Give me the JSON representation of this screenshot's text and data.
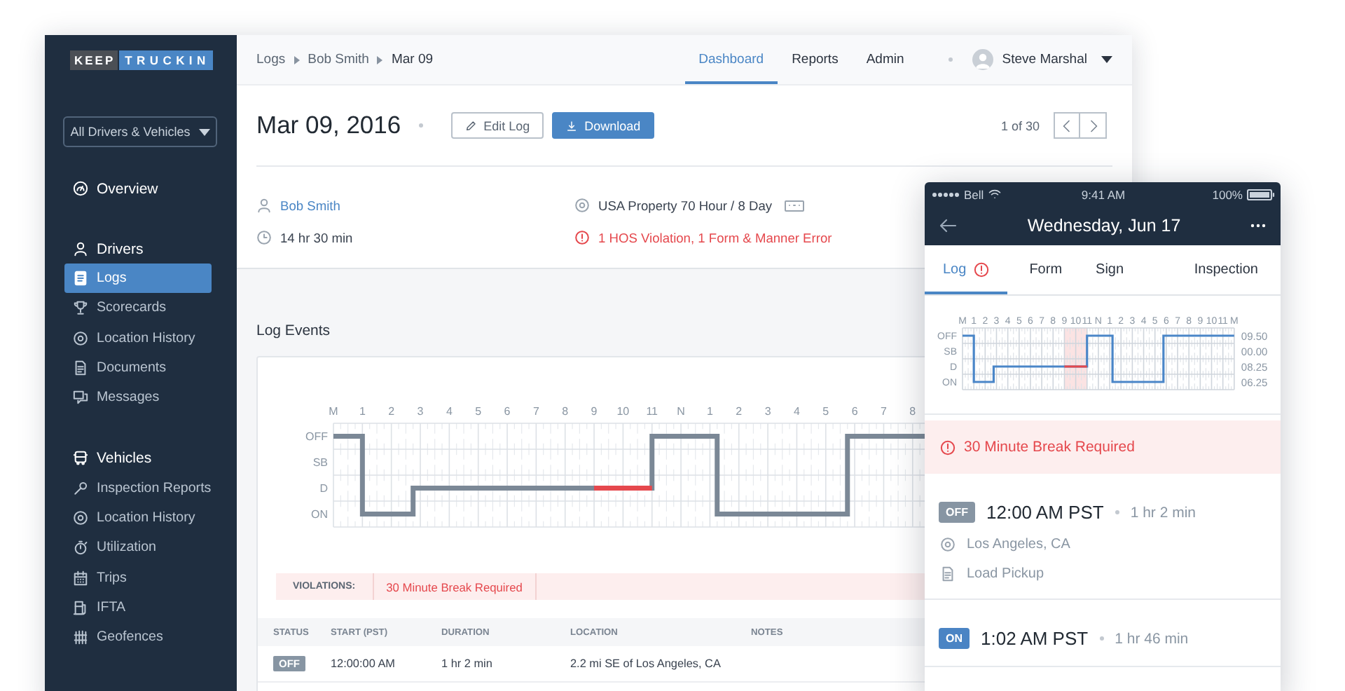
{
  "sidebar": {
    "logo": [
      "KEEP",
      "TRUCKIN"
    ],
    "filter": "All Drivers & Vehicles",
    "nav": [
      {
        "label": "Overview",
        "kind": "top"
      },
      {
        "label": "Drivers",
        "kind": "group",
        "children": [
          {
            "label": "Logs",
            "selected": true
          },
          {
            "label": "Scorecards",
            "selected": false
          },
          {
            "label": "Location History",
            "selected": false
          },
          {
            "label": "Documents",
            "selected": false
          },
          {
            "label": "Messages",
            "selected": false
          }
        ]
      },
      {
        "label": "Vehicles",
        "kind": "group",
        "children": [
          {
            "label": "Inspection Reports",
            "selected": false
          },
          {
            "label": "Location History",
            "selected": false
          },
          {
            "label": "Utilization",
            "selected": false
          },
          {
            "label": "Trips",
            "selected": false
          },
          {
            "label": "IFTA",
            "selected": false
          },
          {
            "label": "Geofences",
            "selected": false
          }
        ]
      }
    ]
  },
  "top_bar": {
    "breadcrumb": [
      "Logs",
      "Bob Smith",
      "Mar 09"
    ],
    "nav": [
      {
        "label": "Dashboard",
        "selected": true
      },
      {
        "label": "Reports",
        "selected": false
      },
      {
        "label": "Admin",
        "selected": false
      }
    ],
    "user": "Steve Marshal"
  },
  "header": {
    "title": "Mar 09, 2016",
    "edit_button": "Edit Log",
    "download_button": "Download",
    "pager": "1 of 30"
  },
  "info": {
    "driver": "Bob Smith",
    "duration": "14 hr 30 min",
    "ruleset": "USA Property 70 Hour / 8 Day",
    "violations": "1 HOS Violation, 1 Form & Manner Error"
  },
  "log_events": {
    "title": "Log Events",
    "graph": {
      "hour_labels": [
        "M",
        "1",
        "2",
        "3",
        "4",
        "5",
        "6",
        "7",
        "8",
        "9",
        "10",
        "11",
        "N",
        "1",
        "2",
        "3",
        "4",
        "5",
        "6",
        "7",
        "8"
      ],
      "status_labels": [
        "OFF",
        "SB",
        "D",
        "ON"
      ]
    },
    "violations_label": "VIOLATIONS:",
    "violations": [
      "30 Minute Break Required"
    ],
    "table": {
      "columns": [
        "STATUS",
        "START (PST)",
        "DURATION",
        "LOCATION",
        "NOTES"
      ],
      "rows": [
        {
          "kind": "off",
          "status": "OFF",
          "start": "12:00:00 AM",
          "duration": "1 hr 2 min",
          "location": "2.2 mi SE of Los Angeles, CA"
        }
      ]
    }
  },
  "phone": {
    "status_bar": {
      "carrier": "Bell",
      "time": "9:41 AM",
      "battery": "100%"
    },
    "title": "Wednesday, Jun 17",
    "tabs": [
      {
        "label": "Log",
        "selected": true,
        "alert": true
      },
      {
        "label": "Form",
        "selected": false,
        "alert": false
      },
      {
        "label": "Sign",
        "selected": false,
        "alert": false
      },
      {
        "label": "Inspection",
        "selected": false,
        "alert": false
      }
    ],
    "graph": {
      "hour_labels": [
        "M",
        "1",
        "2",
        "3",
        "4",
        "5",
        "6",
        "7",
        "8",
        "9",
        "10",
        "11",
        "N",
        "1",
        "2",
        "3",
        "4",
        "5",
        "6",
        "7",
        "8",
        "9",
        "10",
        "11",
        "M"
      ],
      "status_labels": [
        "OFF",
        "SB",
        "D",
        "ON"
      ],
      "totals": [
        "09.50",
        "00.00",
        "08.25",
        "06.25"
      ]
    },
    "alert": "30 Minute Break Required",
    "events": [
      {
        "kind": "off",
        "status": "OFF",
        "time": "12:00 AM PST",
        "duration": "1 hr 2 min",
        "location": "Los Angeles, CA",
        "note": "Load Pickup"
      },
      {
        "kind": "on",
        "status": "ON",
        "time": "1:02 AM PST",
        "duration": "1 hr 46 min"
      }
    ]
  }
}
